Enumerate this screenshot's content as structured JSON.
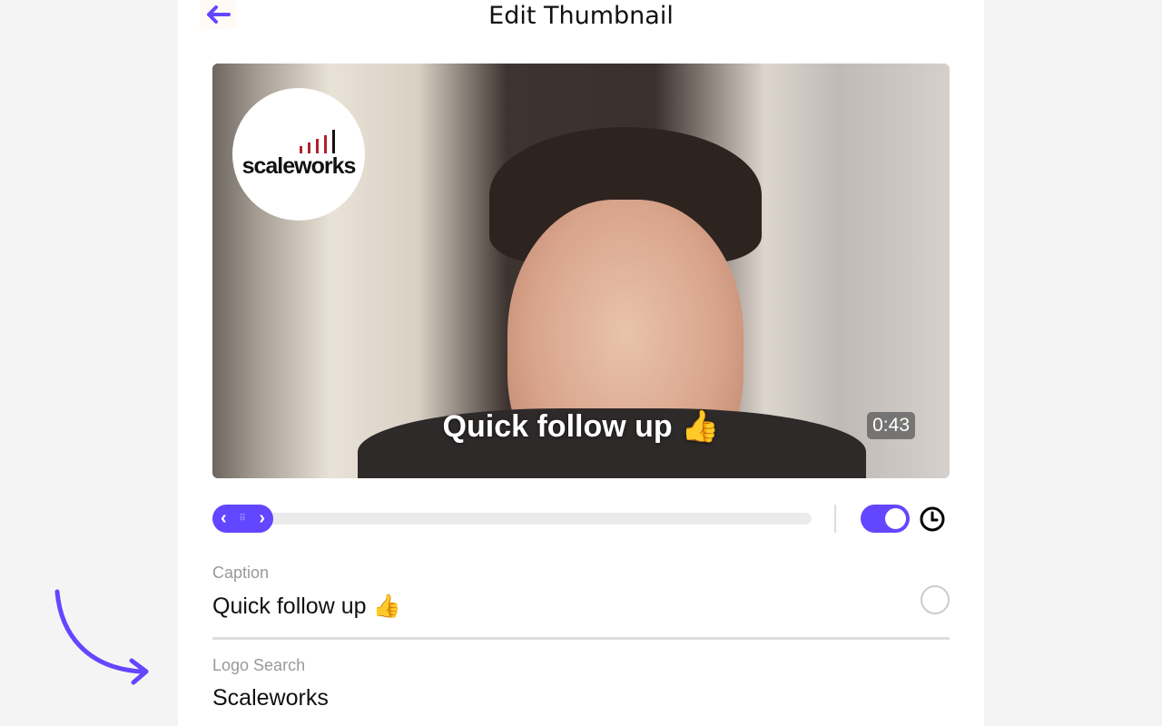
{
  "header": {
    "title": "Edit Thumbnail",
    "back_icon": "arrow-left-icon"
  },
  "video": {
    "caption": "Quick follow up 👍",
    "duration": "0:43",
    "logo_text": "scaleworks"
  },
  "timeline": {
    "position_percent": 0,
    "toggle_on": true
  },
  "fields": {
    "caption": {
      "label": "Caption",
      "value": "Quick follow up 👍"
    },
    "logo_search": {
      "label": "Logo Search",
      "value": "Scaleworks"
    }
  },
  "colors": {
    "accent": "#6346ff"
  }
}
